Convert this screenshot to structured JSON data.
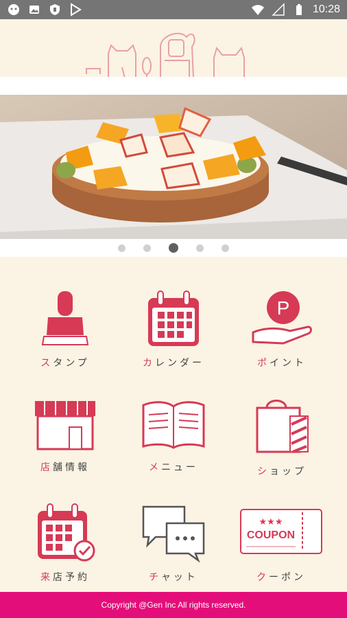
{
  "status_bar": {
    "time": "10:28"
  },
  "carousel": {
    "active_index": 2,
    "count": 5
  },
  "menu": [
    {
      "id": "stamp",
      "first": "ス",
      "rest": "タンプ"
    },
    {
      "id": "calendar",
      "first": "カ",
      "rest": "レンダー"
    },
    {
      "id": "point",
      "first": "ポ",
      "rest": "イント"
    },
    {
      "id": "store-info",
      "first": "店",
      "rest": "舗情報"
    },
    {
      "id": "menu",
      "first": "メ",
      "rest": "ニュー"
    },
    {
      "id": "shop",
      "first": "シ",
      "rest": "ョップ"
    },
    {
      "id": "reservation",
      "first": "来",
      "rest": "店予約"
    },
    {
      "id": "chat",
      "first": "チ",
      "rest": "ャット"
    },
    {
      "id": "coupon",
      "first": "ク",
      "rest": "ーポン"
    }
  ],
  "icons": {
    "point_letter": "P",
    "coupon_text": "COUPON",
    "coupon_stars": "★★★"
  },
  "footer": {
    "copyright": "Copyright @Gen Inc All rights reserved."
  },
  "colors": {
    "accent": "#d63a55",
    "footer": "#e40e7a",
    "background": "#fbf3e4"
  }
}
